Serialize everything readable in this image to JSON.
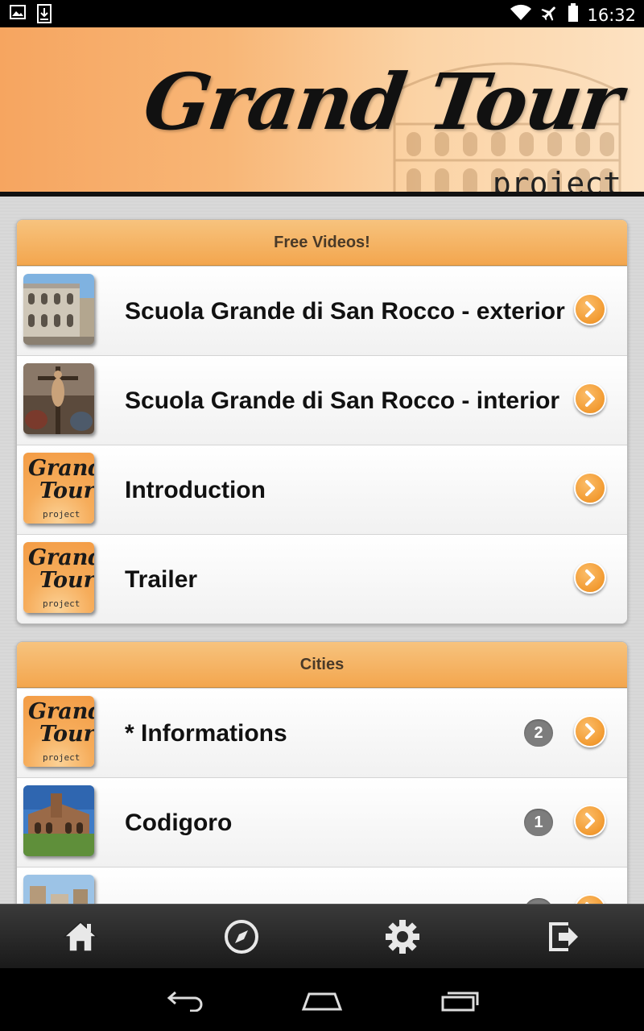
{
  "status_bar": {
    "time": "16:32",
    "left_icons": [
      "image-icon",
      "download-icon"
    ],
    "right_icons": [
      "wifi-icon",
      "airplane-icon",
      "battery-icon"
    ]
  },
  "header": {
    "brand_title": "Grand Tour",
    "brand_subtitle": "project"
  },
  "sections": [
    {
      "title": "Free Videos!",
      "items": [
        {
          "label": "Scuola Grande di San Rocco - exterior",
          "thumb": "building-exterior"
        },
        {
          "label": "Scuola Grande di San Rocco - interior",
          "thumb": "crucifix-painting"
        },
        {
          "label": "Introduction",
          "thumb": "grand-tour-logo"
        },
        {
          "label": "Trailer",
          "thumb": "grand-tour-logo"
        }
      ]
    },
    {
      "title": "Cities",
      "items": [
        {
          "label": "* Informations",
          "badge": "2",
          "thumb": "grand-tour-logo"
        },
        {
          "label": "Codigoro",
          "badge": "1",
          "thumb": "abbey-photo"
        },
        {
          "label": "",
          "badge": "",
          "thumb": "city-photo"
        }
      ]
    }
  ],
  "logo_thumb": {
    "line1": "Grand",
    "line2": "Tour",
    "line3": "project"
  },
  "bottom_nav": [
    "home-icon",
    "compass-icon",
    "gear-icon",
    "exit-icon"
  ],
  "system_nav": [
    "back-icon",
    "home-sys-icon",
    "recents-icon"
  ],
  "colors": {
    "accent": "#f3a64e",
    "header_bg": "#f6a560",
    "badge": "#7d7d7d"
  }
}
